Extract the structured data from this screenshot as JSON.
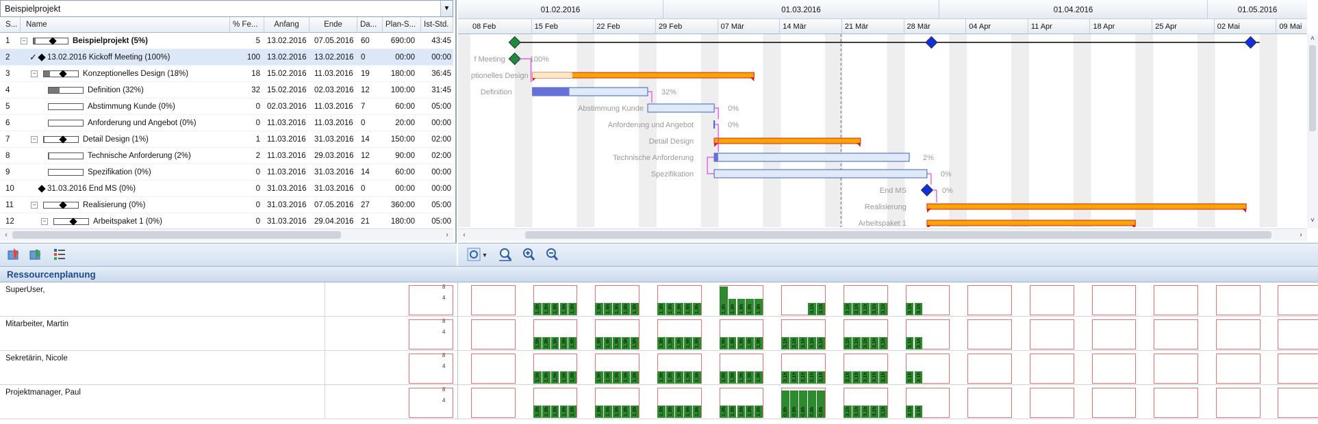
{
  "project_select": {
    "value": "Beispielprojekt"
  },
  "table": {
    "headers": [
      "S...",
      "Name",
      "% Fe...",
      "Anfang",
      "Ende",
      "Da...",
      "Plan-S...",
      "Ist-Std."
    ],
    "rows": [
      {
        "n": "1",
        "name": "Beispielprojekt (5%)",
        "pct": "5",
        "start": "13.02.2016",
        "end": "07.05.2016",
        "dur": "60",
        "plan": "690:00",
        "actual": "43:45",
        "level": 0,
        "type": "summary",
        "expander": "⊟",
        "progress": 0.05,
        "bold": true
      },
      {
        "n": "2",
        "name": "13.02.2016 Kickoff Meeting (100%)",
        "pct": "100",
        "start": "13.02.2016",
        "end": "13.02.2016",
        "dur": "0",
        "plan": "00:00",
        "actual": "00:00",
        "level": 1,
        "type": "milestone",
        "check": "✓",
        "selected": true
      },
      {
        "n": "3",
        "name": "Konzeptionelles Design (18%)",
        "pct": "18",
        "start": "15.02.2016",
        "end": "11.03.2016",
        "dur": "19",
        "plan": "180:00",
        "actual": "36:45",
        "level": 1,
        "type": "summary",
        "expander": "⊟",
        "progress": 0.18
      },
      {
        "n": "4",
        "name": "Definition (32%)",
        "pct": "32",
        "start": "15.02.2016",
        "end": "02.03.2016",
        "dur": "12",
        "plan": "100:00",
        "actual": "31:45",
        "level": 2,
        "type": "task",
        "progress": 0.32
      },
      {
        "n": "5",
        "name": "Abstimmung Kunde (0%)",
        "pct": "0",
        "start": "02.03.2016",
        "end": "11.03.2016",
        "dur": "7",
        "plan": "60:00",
        "actual": "05:00",
        "level": 2,
        "type": "task",
        "progress": 0
      },
      {
        "n": "6",
        "name": "Anforderung und Angebot (0%)",
        "pct": "0",
        "start": "11.03.2016",
        "end": "11.03.2016",
        "dur": "0",
        "plan": "20:00",
        "actual": "00:00",
        "level": 2,
        "type": "task",
        "progress": 0
      },
      {
        "n": "7",
        "name": "Detail Design (1%)",
        "pct": "1",
        "start": "11.03.2016",
        "end": "31.03.2016",
        "dur": "14",
        "plan": "150:00",
        "actual": "02:00",
        "level": 1,
        "type": "summary",
        "expander": "⊟",
        "progress": 0.01
      },
      {
        "n": "8",
        "name": "Technische Anforderung (2%)",
        "pct": "2",
        "start": "11.03.2016",
        "end": "29.03.2016",
        "dur": "12",
        "plan": "90:00",
        "actual": "02:00",
        "level": 2,
        "type": "task",
        "progress": 0.02
      },
      {
        "n": "9",
        "name": "Spezifikation (0%)",
        "pct": "0",
        "start": "11.03.2016",
        "end": "31.03.2016",
        "dur": "14",
        "plan": "60:00",
        "actual": "00:00",
        "level": 2,
        "type": "task",
        "progress": 0
      },
      {
        "n": "10",
        "name": "31.03.2016 End MS (0%)",
        "pct": "0",
        "start": "31.03.2016",
        "end": "31.03.2016",
        "dur": "0",
        "plan": "00:00",
        "actual": "00:00",
        "level": 1,
        "type": "milestone"
      },
      {
        "n": "11",
        "name": "Realisierung (0%)",
        "pct": "0",
        "start": "31.03.2016",
        "end": "07.05.2016",
        "dur": "27",
        "plan": "360:00",
        "actual": "05:00",
        "level": 1,
        "type": "summary",
        "expander": "⊟",
        "progress": 0
      },
      {
        "n": "12",
        "name": "Arbeitspaket 1 (0%)",
        "pct": "0",
        "start": "31.03.2016",
        "end": "29.04.2016",
        "dur": "21",
        "plan": "180:00",
        "actual": "05:00",
        "level": 2,
        "type": "summary",
        "expander": "⊟",
        "progress": 0
      }
    ]
  },
  "gantt": {
    "months": [
      "01.02.2016",
      "01.03.2016",
      "01.04.2016",
      "01.05.2016"
    ],
    "weeks": [
      "08 Feb",
      "15 Feb",
      "22 Feb",
      "29 Feb",
      "07 Mär",
      "14 Mär",
      "21 Mär",
      "28 Mär",
      "04 Apr",
      "11 Apr",
      "18 Apr",
      "25 Apr",
      "02 Mai",
      "09 Mai"
    ],
    "labels": [
      "f Meeting",
      "ptionelles Design",
      "Definition",
      "Abstimmung Kunde",
      "Anforderung und Angebot",
      "Detail Design",
      "Technische Anforderung",
      "Spezifikation",
      "End MS",
      "Realisierung",
      "Arbeitspaket 1"
    ],
    "pcts": [
      "100%",
      "32%",
      "0%",
      "0%",
      "2%",
      "0%",
      "0%"
    ],
    "colors": {
      "summary": "#f7a500",
      "summary_border": "#e02020",
      "task": "#dfe9f8",
      "task_border": "#3b63c4",
      "task_fill": "#6570d8",
      "milestone_green": "#1e8a3c",
      "milestone_blue": "#1030e0",
      "link": "#e020e0"
    }
  },
  "resources": {
    "title": "Ressourcenplanung",
    "scale": [
      "8",
      "4"
    ],
    "rows": [
      {
        "name": "SuperUser,"
      },
      {
        "name": "Mitarbeiter, Martin"
      },
      {
        "name": "Sekretärin, Nicole"
      },
      {
        "name": "Projektmanager, Paul"
      }
    ],
    "bar_labels": [
      "1,9h",
      "3,1h",
      "0,8h"
    ]
  },
  "icons": [
    "project-up-icon",
    "project-down-icon",
    "list-icon",
    "zoom-fit-icon",
    "dropdown-arrow-icon",
    "zoom-date-icon",
    "zoom-in-icon",
    "zoom-out-icon"
  ]
}
